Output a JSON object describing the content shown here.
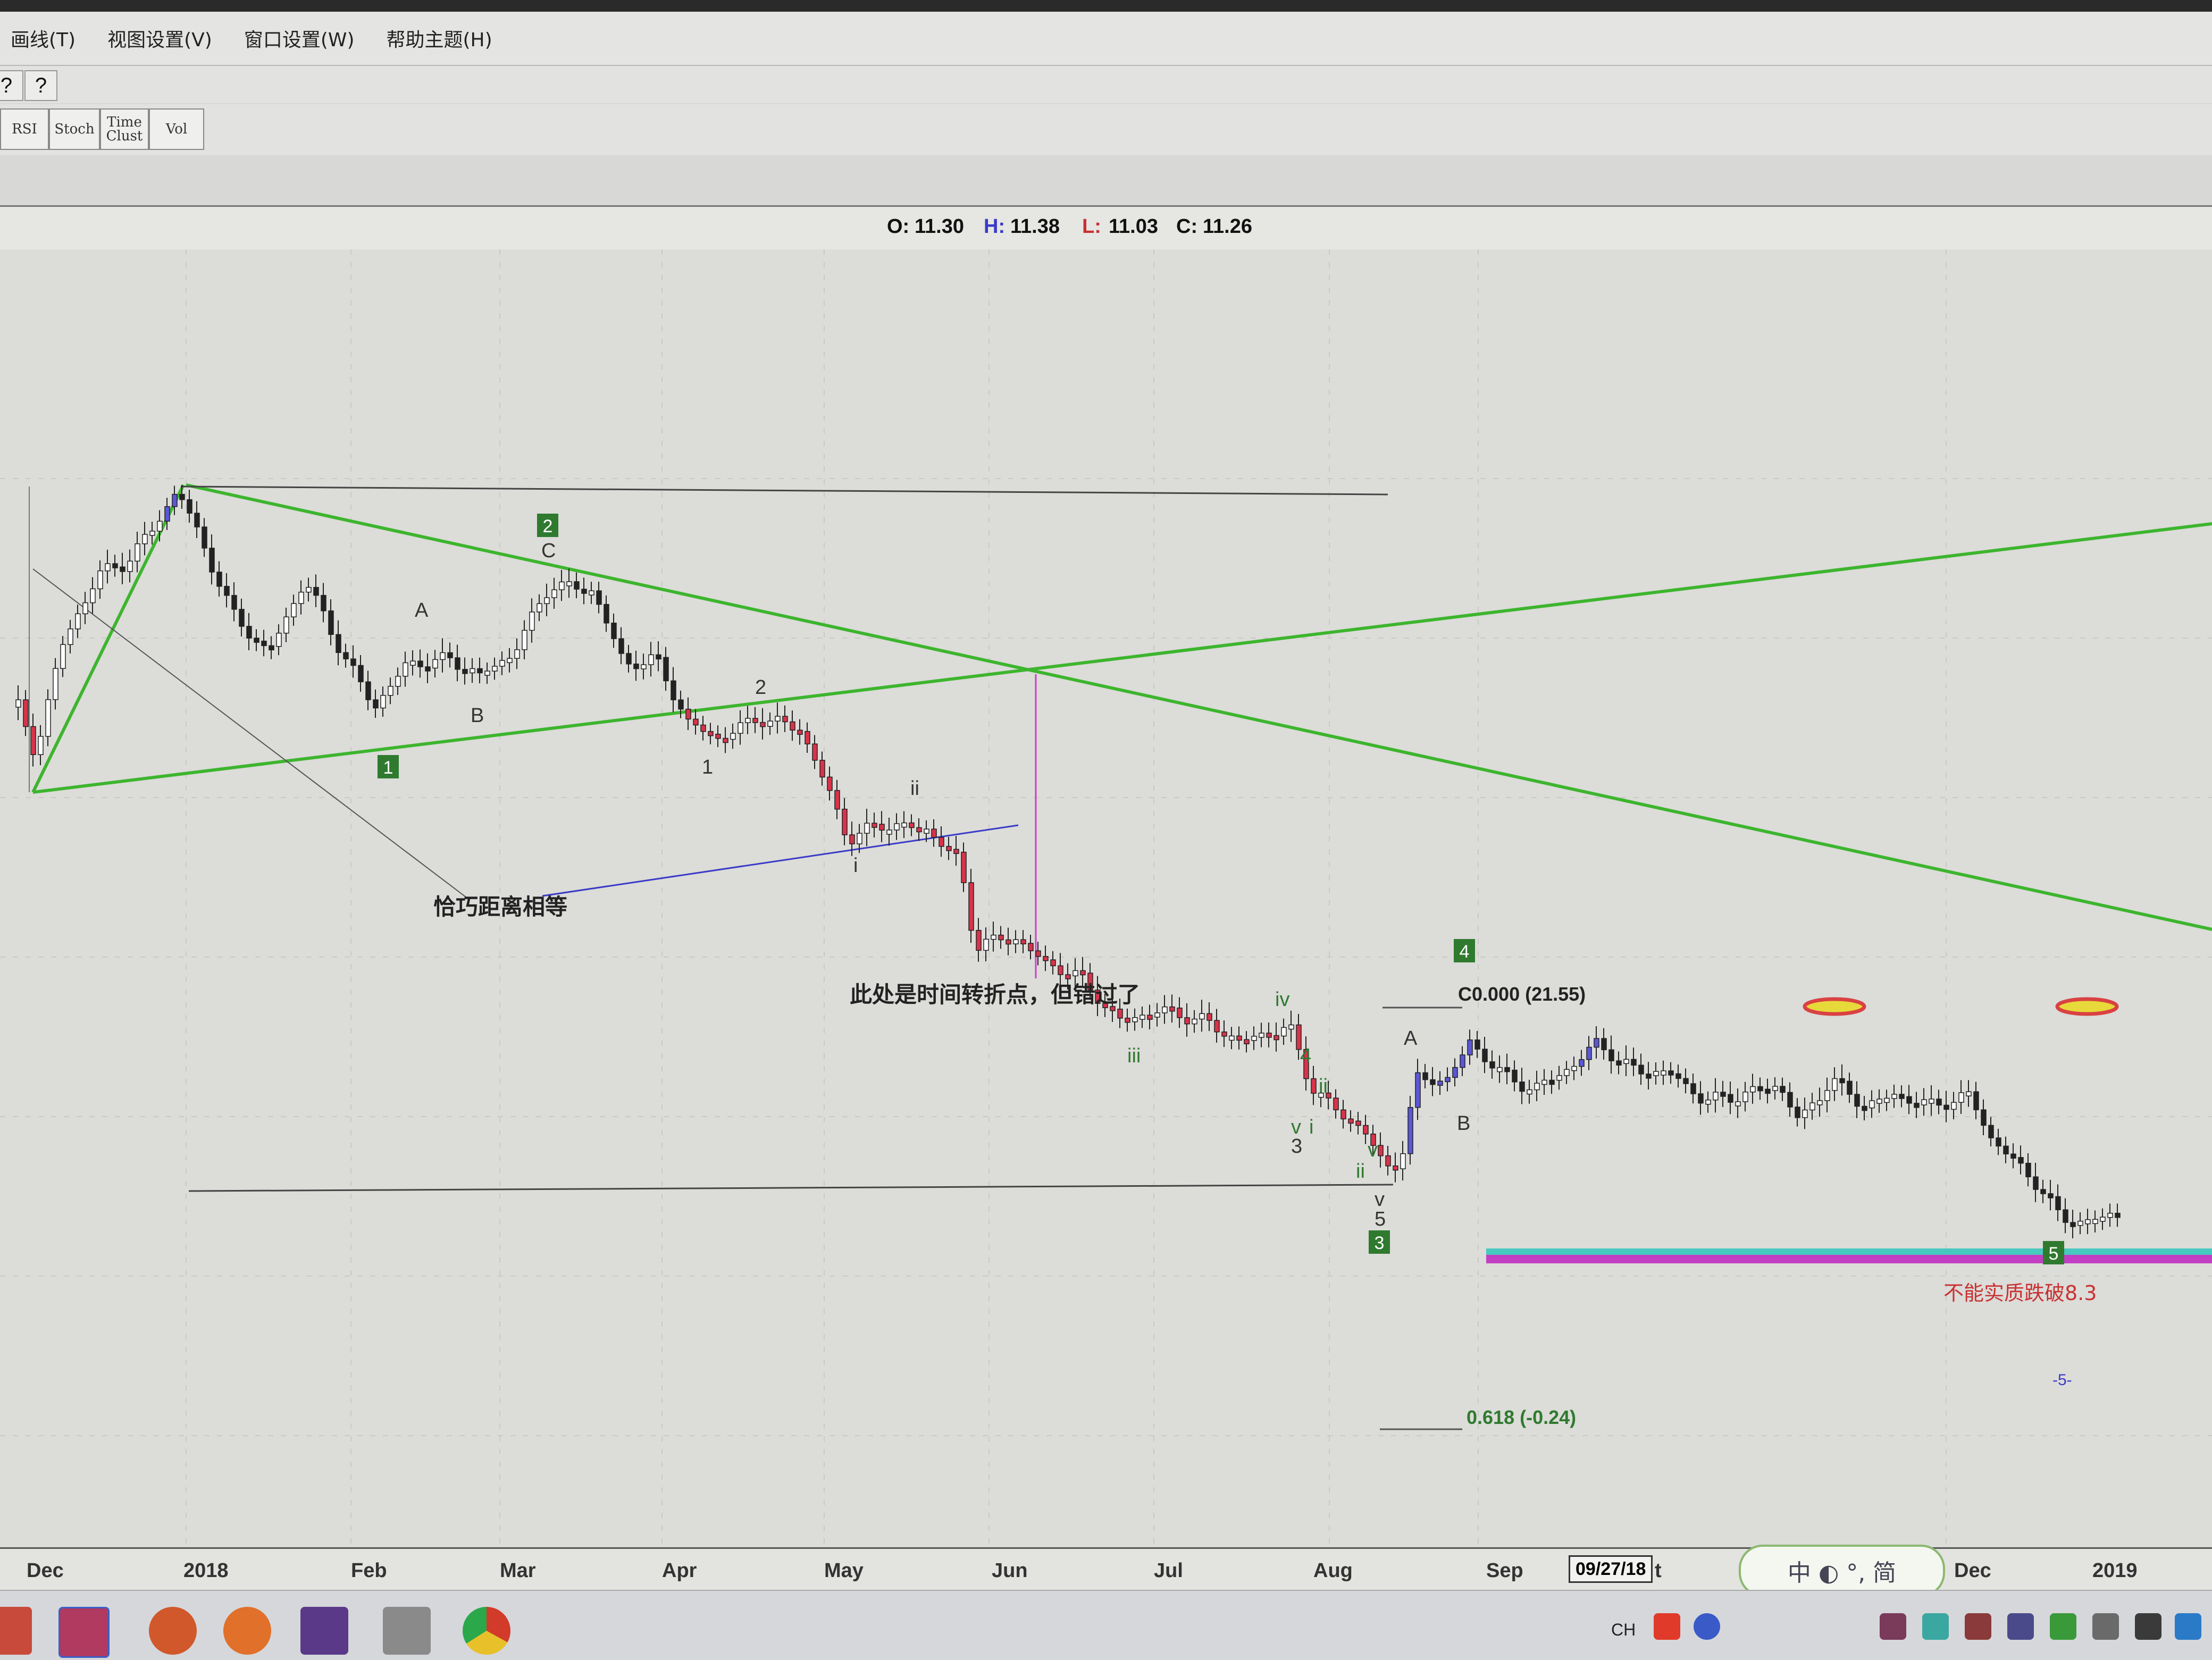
{
  "menu": {
    "items": [
      "画线(T)",
      "视图设置(V)",
      "窗口设置(W)",
      "帮助主题(H)"
    ]
  },
  "toolbar": {
    "help_glyph": "?",
    "whatsthis_glyph": "?"
  },
  "indicators": {
    "rsi": "RSI",
    "stoch": "Stoch",
    "time_clust_1": "Time",
    "time_clust_2": "Clust",
    "vol": "Vol"
  },
  "ohlc": {
    "o_label": "O:",
    "o": "11.30",
    "h_label": "H:",
    "h": "11.38",
    "l_label": "L:",
    "l": "11.03",
    "c_label": "C:",
    "c": "11.26"
  },
  "annotations": {
    "equal_distance": "恰巧距离相等",
    "time_turning_point": "此处是时间转折点，但错过了",
    "support_note": "不能实质跌破8.3",
    "fib_top": "C0.000 (21.55)",
    "fib_bottom": "0.618 (-0.24)",
    "bottom_mark": "-5-"
  },
  "wave_labels": {
    "box1": "1",
    "box2": "2",
    "box3": "3",
    "box4": "4",
    "box5": "5",
    "A1": "A",
    "B1": "B",
    "C1": "C",
    "n1": "1",
    "n2": "2",
    "i1": "i",
    "ii1": "ii",
    "iii1": "iii",
    "iv1": "iv",
    "v1": "v",
    "n3": "3",
    "i2": "i",
    "ii2": "ii",
    "iv2": "4",
    "v2": "v",
    "ii3": "ii",
    "v3": "v",
    "n5": "5",
    "A2": "A",
    "B2": "B"
  },
  "xaxis": {
    "labels": [
      "Dec",
      "2018",
      "Feb",
      "Mar",
      "Apr",
      "May",
      "Jun",
      "Jul",
      "Aug",
      "Sep",
      "Dec",
      "2019"
    ],
    "cursor_date": "09/27/18",
    "cursor_suffix": "t"
  },
  "ime": {
    "text": "中 ◐ °, 简"
  },
  "taskbar": {
    "lang": "CH"
  },
  "colors": {
    "green_line": "#3db52e",
    "bear_candle": "#d8334a",
    "bull_candle": "#ffffff",
    "bull_blue": "#5b57d6",
    "support_cyan": "#47c9c0",
    "support_magenta": "#c23fc4",
    "oval_red": "#d94242",
    "oval_yellow": "#e8d93a"
  },
  "chart_data": {
    "type": "candlestick",
    "approximate_closes": [
      {
        "period": "Dec 2017",
        "close": 18.5
      },
      {
        "period": "Jan 2018 top",
        "close": 21.55
      },
      {
        "period": "Feb 2018",
        "close": 16.8
      },
      {
        "period": "Mar 2018",
        "close": 19.8
      },
      {
        "period": "Apr 2018",
        "close": 17.2
      },
      {
        "period": "May 2018",
        "close": 15.5
      },
      {
        "period": "Jun 2018",
        "close": 13.0
      },
      {
        "period": "Jul 2018",
        "close": 12.0
      },
      {
        "period": "Aug 2018 low",
        "close": 9.6
      },
      {
        "period": "Sep 2018",
        "close": 11.26
      },
      {
        "period": "Dec 2018",
        "close": 8.3
      }
    ]
  }
}
